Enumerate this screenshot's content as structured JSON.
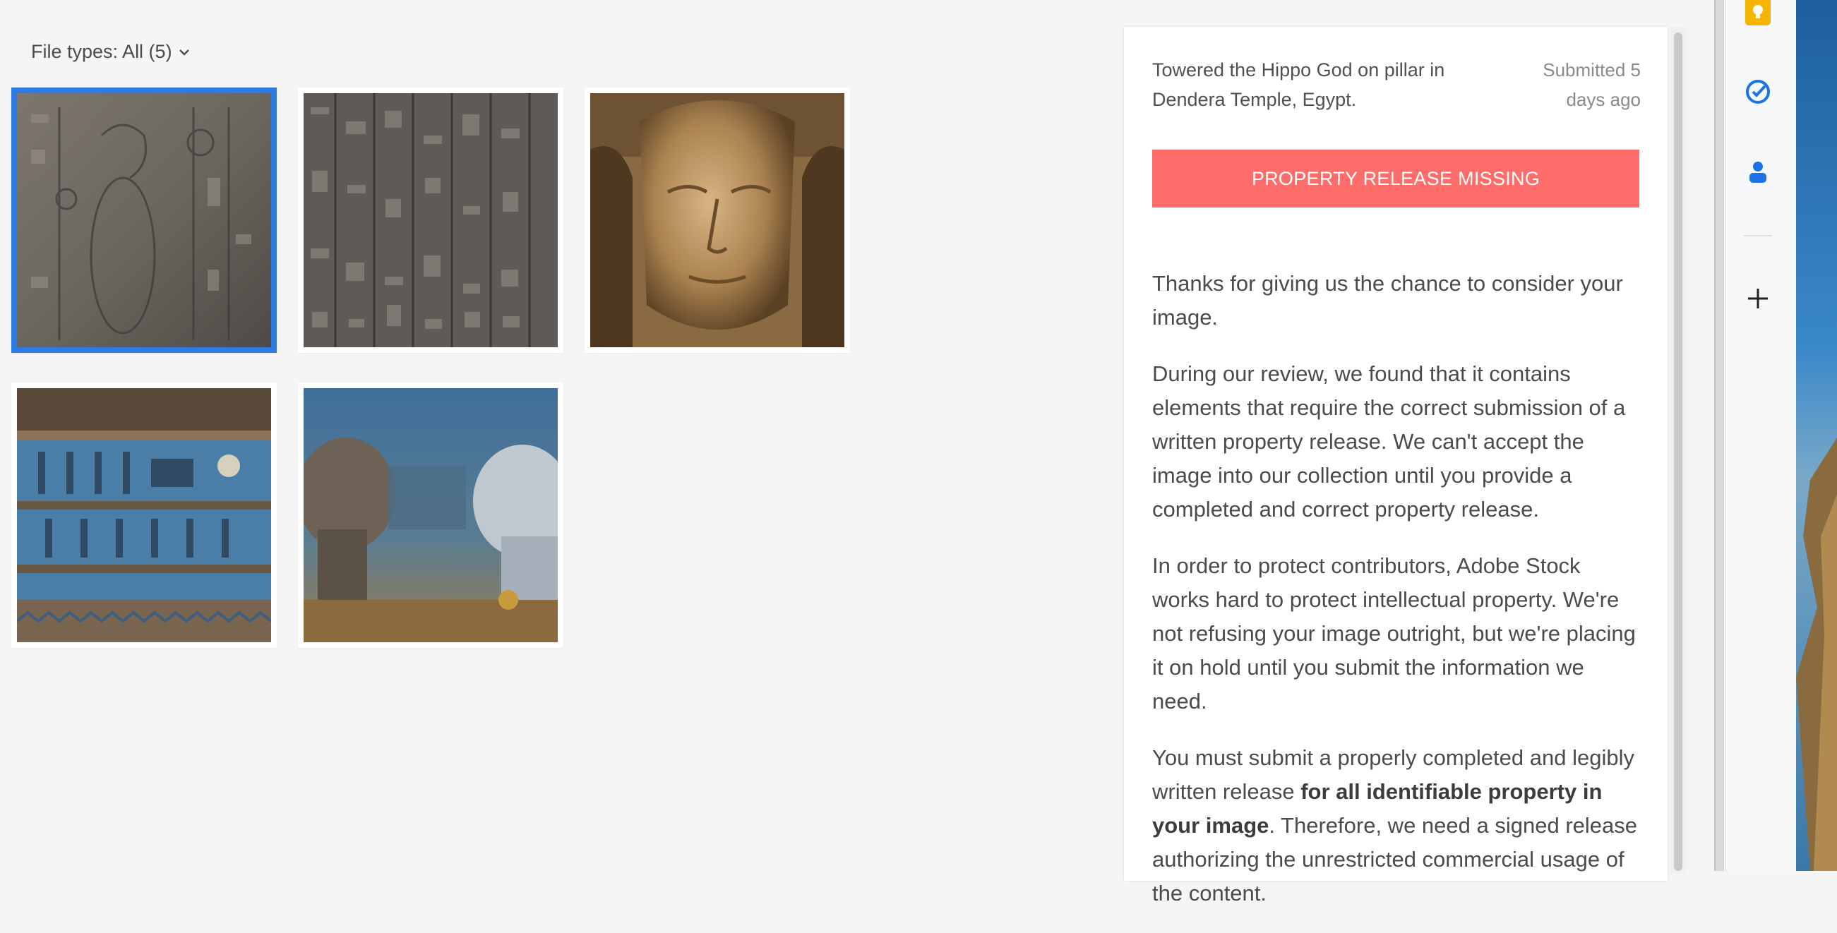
{
  "filter": {
    "label": "File types: All (5)"
  },
  "gallery": {
    "items": [
      {
        "name": "thumbnail-carved-relief",
        "selected": true
      },
      {
        "name": "thumbnail-hieroglyph-columns",
        "selected": false
      },
      {
        "name": "thumbnail-hathor-face",
        "selected": false
      },
      {
        "name": "thumbnail-blue-ceiling-frieze",
        "selected": false
      },
      {
        "name": "thumbnail-pillars-ceiling",
        "selected": false
      }
    ]
  },
  "detail": {
    "title": "Towered the Hippo God on pillar in Dendera Temple, Egypt.",
    "submitted": "Submitted 5 days ago",
    "warning": "PROPERTY RELEASE MISSING",
    "paragraphs": {
      "p1": "Thanks for giving us the chance to consider your image.",
      "p2": "During our review, we found that it contains elements that require the correct submission of a written property release. We can't accept the image into our collection until you provide a completed and correct property release.",
      "p3": "In order to protect contributors, Adobe Stock works hard to protect intellectual property. We're not refusing your image outright, but we're placing it on hold until you submit the information we need.",
      "p4_start": "You must submit a properly completed and legibly written release ",
      "p4_bold": "for all identifiable property in your image",
      "p4_end": ". Therefore, we need a signed release authorizing the unrestricted commercial usage of the content."
    }
  },
  "rail": {
    "icons": [
      "keep-icon",
      "tasks-icon",
      "contacts-icon",
      "add-icon"
    ]
  },
  "colors": {
    "selection": "#2d7be5",
    "warning_bg": "#ff6d6b",
    "warning_text": "#ffffff",
    "keep": "#f6b400",
    "tasks": "#1a73e8",
    "contacts": "#1a73e8"
  }
}
